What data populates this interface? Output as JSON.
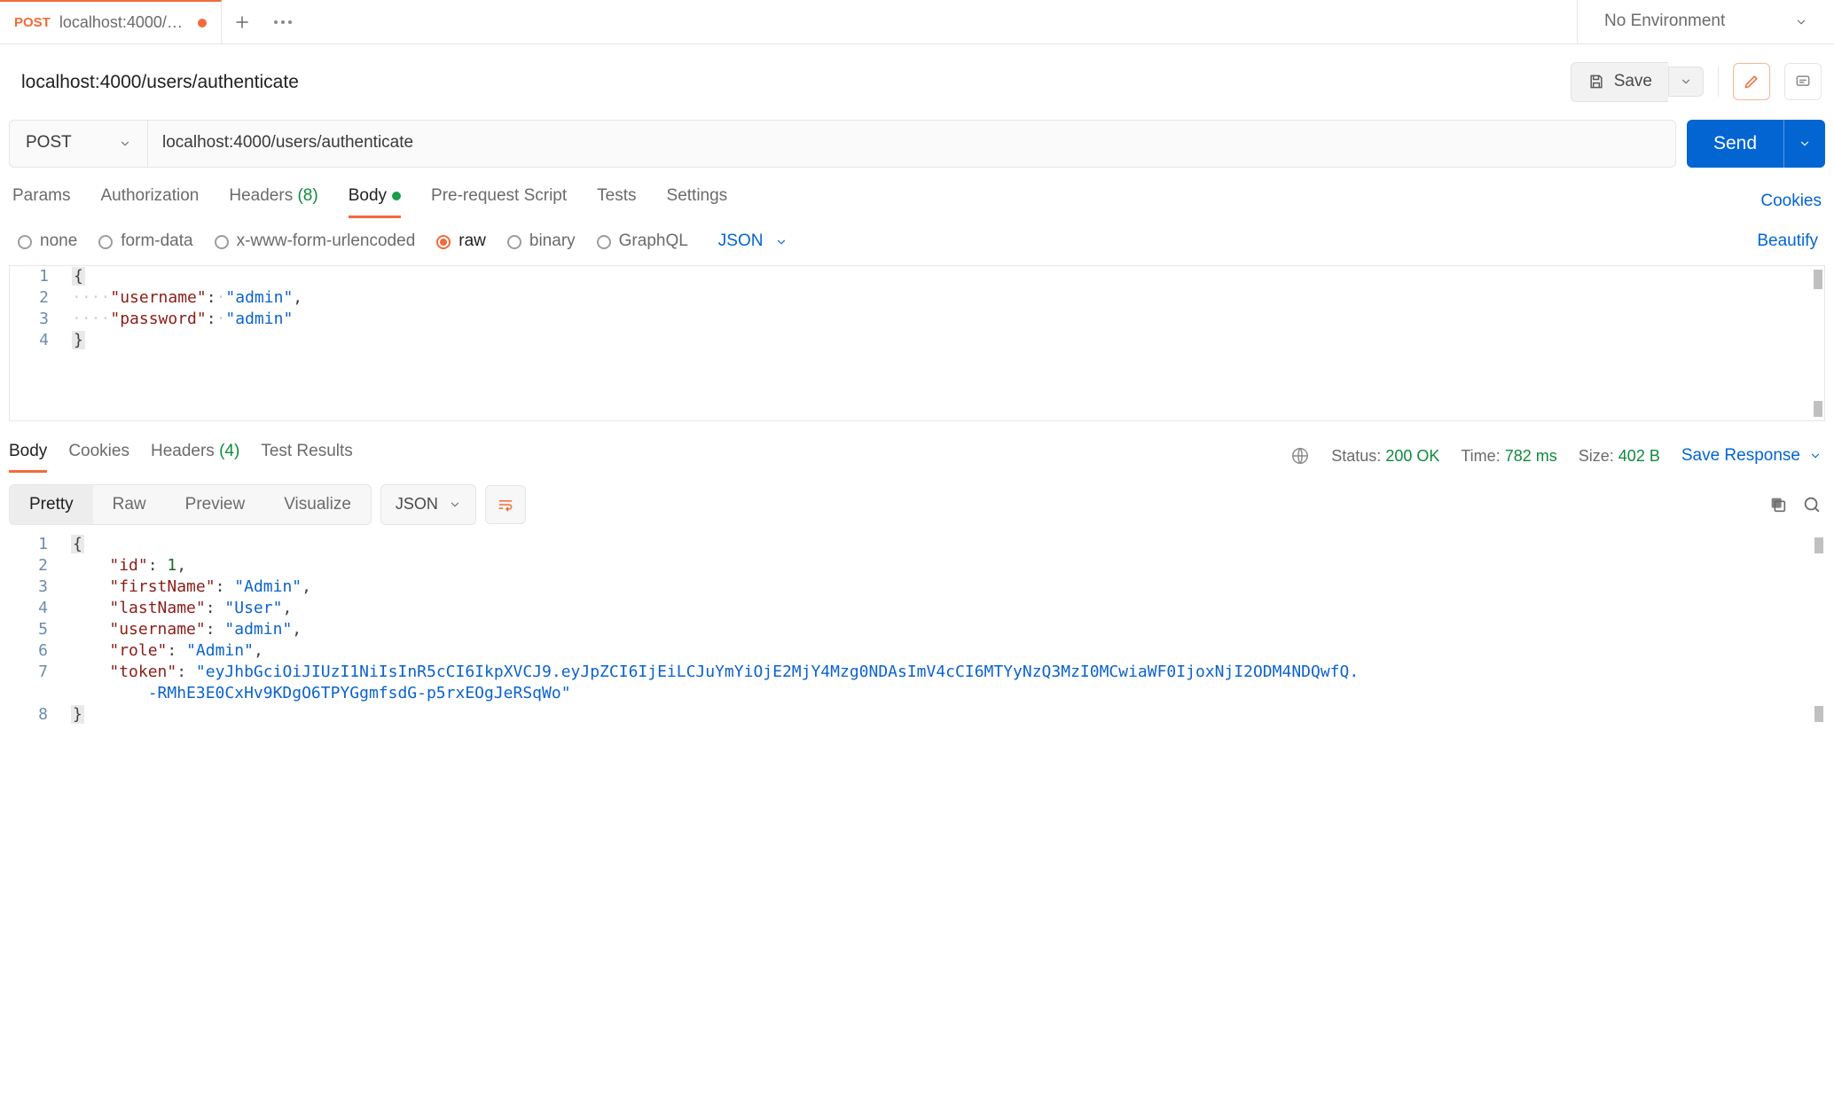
{
  "tabs": {
    "active": {
      "method": "POST",
      "title": "localhost:4000/u…"
    },
    "env_label": "No Environment"
  },
  "request": {
    "title": "localhost:4000/users/authenticate",
    "save_label": "Save",
    "method": "POST",
    "url": "localhost:4000/users/authenticate",
    "send_label": "Send",
    "tabs": {
      "params": "Params",
      "auth": "Authorization",
      "headers_label": "Headers",
      "headers_count": "(8)",
      "body": "Body",
      "prereq": "Pre-request Script",
      "tests": "Tests",
      "settings": "Settings",
      "cookies": "Cookies"
    },
    "body_types": {
      "none": "none",
      "form": "form-data",
      "url": "x-www-form-urlencoded",
      "raw": "raw",
      "binary": "binary",
      "gql": "GraphQL",
      "lang": "JSON",
      "beautify": "Beautify"
    },
    "body_lines": {
      "l1": "1",
      "l2": "2",
      "l3": "3",
      "l4": "4",
      "k_user": "\"username\"",
      "v_user": "\"admin\"",
      "k_pass": "\"password\"",
      "v_pass": "\"admin\""
    }
  },
  "response": {
    "tabs": {
      "body": "Body",
      "cookies": "Cookies",
      "headers_label": "Headers",
      "headers_count": "(4)",
      "tests": "Test Results"
    },
    "meta": {
      "status_l": "Status:",
      "status_v": "200 OK",
      "time_l": "Time:",
      "time_v": "782 ms",
      "size_l": "Size:",
      "size_v": "402 B",
      "save_resp": "Save Response"
    },
    "view": {
      "pretty": "Pretty",
      "raw": "Raw",
      "preview": "Preview",
      "visualize": "Visualize",
      "lang": "JSON"
    },
    "body": {
      "l1": "1",
      "l2": "2",
      "l3": "3",
      "l4": "4",
      "l5": "5",
      "l6": "6",
      "l7": "7",
      "l8": "8",
      "k_id": "\"id\"",
      "v_id": "1",
      "k_fn": "\"firstName\"",
      "v_fn": "\"Admin\"",
      "k_ln": "\"lastName\"",
      "v_ln": "\"User\"",
      "k_un": "\"username\"",
      "v_un": "\"admin\"",
      "k_ro": "\"role\"",
      "v_ro": "\"Admin\"",
      "k_tk": "\"token\"",
      "v_tk1": "\"eyJhbGciOiJIUzI1NiIsInR5cCI6IkpXVCJ9.eyJpZCI6IjEiLCJuYmYiOjE2MjY4Mzg0NDAsImV4cCI6MTYyNzQ3MzI0MCwiaWF0IjoxNjI2ODM4NDQwfQ.",
      "v_tk2": "-RMhE3E0CxHv9KDgO6TPYGgmfsdG-p5rxEOgJeRSqWo\""
    }
  }
}
